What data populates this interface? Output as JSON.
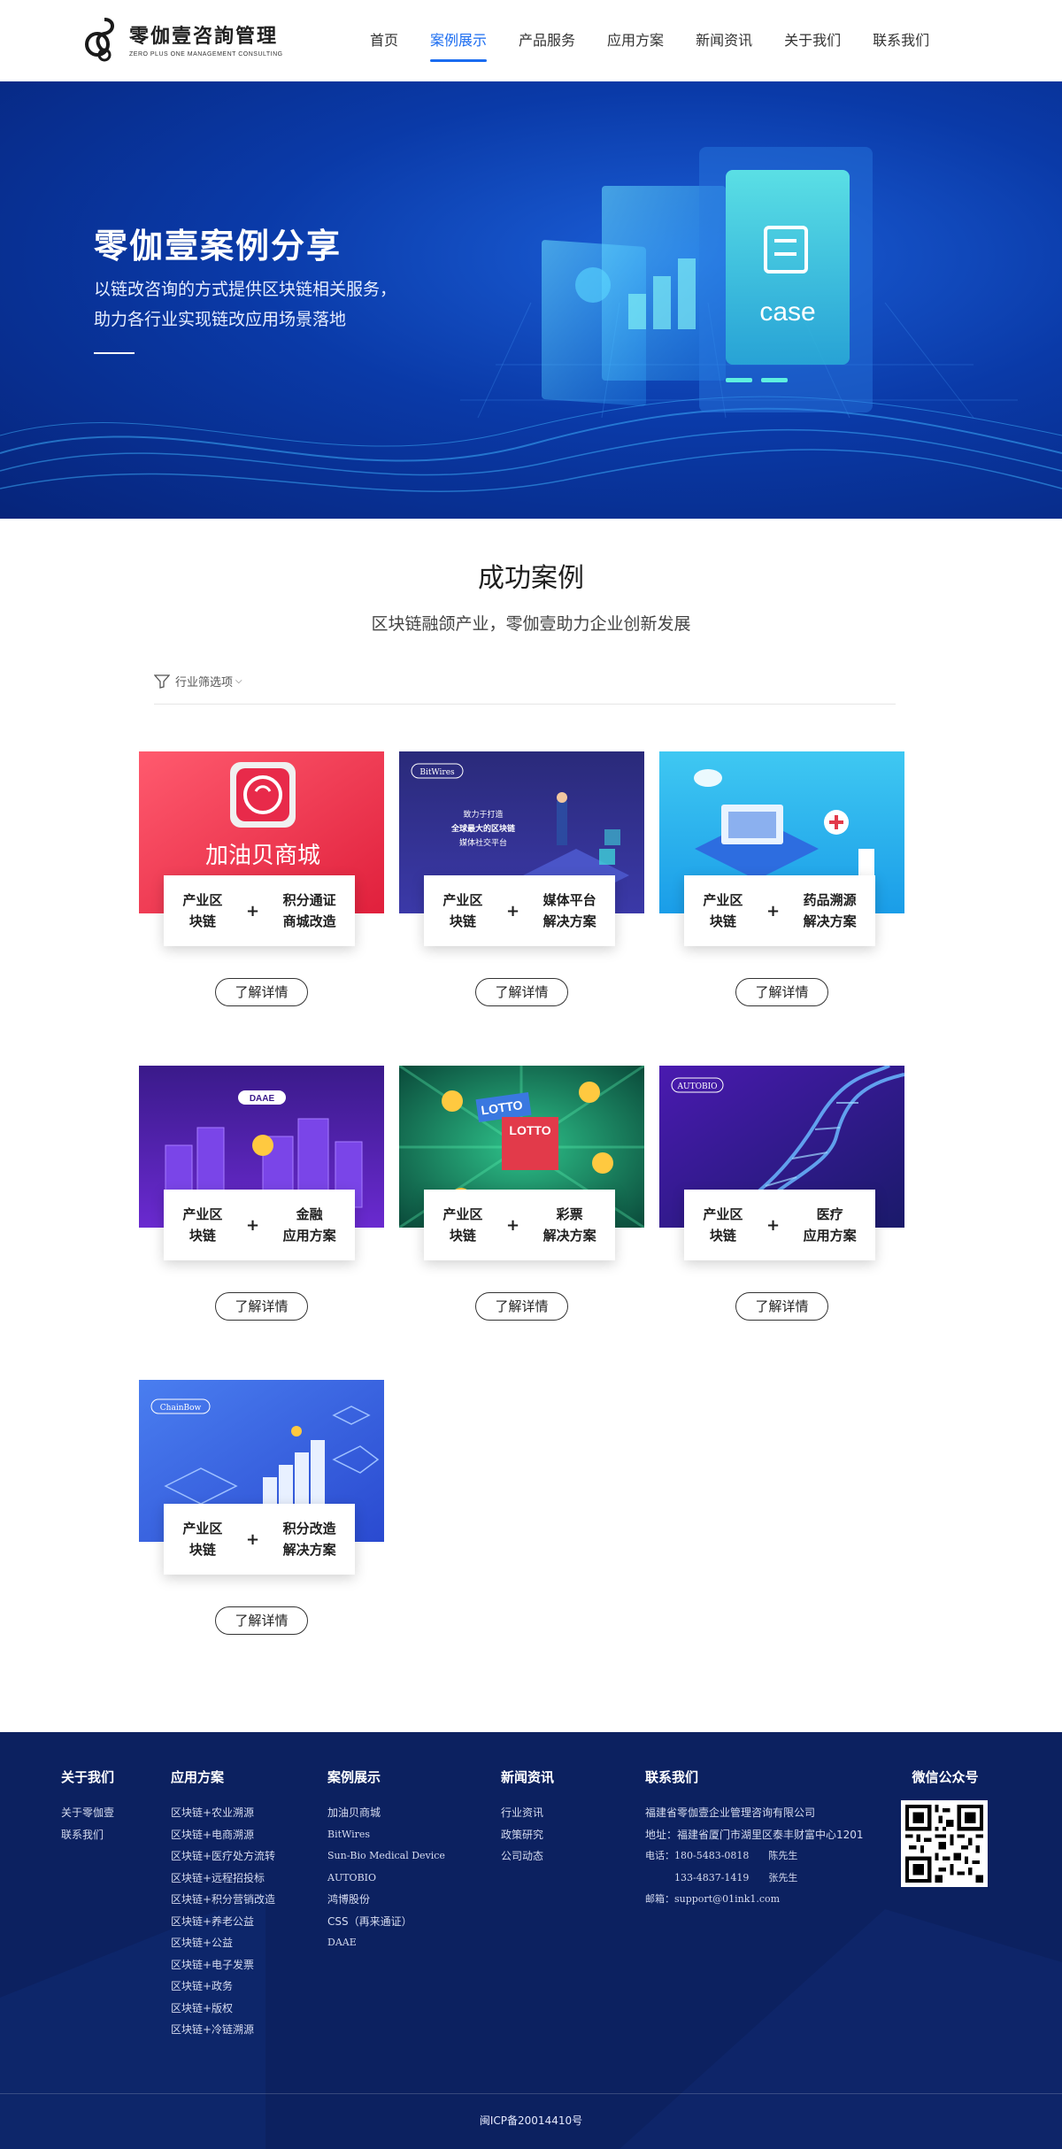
{
  "header": {
    "logo_cn": "零伽壹咨詢管理",
    "logo_en": "ZERO PLUS ONE MANAGEMENT CONSULTING",
    "nav": [
      "首页",
      "案例展示",
      "产品服务",
      "应用方案",
      "新闻资讯",
      "关于我们",
      "联系我们"
    ],
    "active_nav": "案例展示"
  },
  "banner": {
    "title": "零伽壹案例分享",
    "sub_line1": "以链改咨询的方式提供区块链相关服务，",
    "sub_line2": "助力各行业实现链改应用场景落地",
    "panel_text": "case"
  },
  "section": {
    "title": "成功案例",
    "subtitle": "区块链融颌产业，零伽壹助力企业创新发展",
    "filter_label": "行业筛选项"
  },
  "cards": [
    {
      "left": "产业区\n块链",
      "right": "积分通证\n商城改造",
      "button": "了解详情",
      "img_text": "加油贝商城"
    },
    {
      "left": "产业区\n块链",
      "right": "媒体平台\n解决方案",
      "button": "了解详情",
      "img_text": "BitWires",
      "img_text2": "致力于打造",
      "img_text3": "全球最大的区块链",
      "img_text4": "媒体社交平台"
    },
    {
      "left": "产业区\n块链",
      "right": "药品溯源\n解决方案",
      "button": "了解详情"
    },
    {
      "left": "产业区\n块链",
      "right": "金融\n应用方案",
      "button": "了解详情",
      "img_text": "DAAE"
    },
    {
      "left": "产业区\n块链",
      "right": "彩票\n解决方案",
      "button": "了解详情",
      "img_text": "LOTTO",
      "img_text2": "LOTTO"
    },
    {
      "left": "产业区\n块链",
      "right": "医疗\n应用方案",
      "button": "了解详情",
      "img_text": "AUTOBIO"
    },
    {
      "left": "产业区\n块链",
      "right": "积分改造\n解决方案",
      "button": "了解详情",
      "img_text": "ChainBow"
    }
  ],
  "footer": {
    "about": {
      "title": "关于我们",
      "items": [
        "关于零伽壹",
        "联系我们"
      ]
    },
    "solutions": {
      "title": "应用方案",
      "items": [
        "区块链+农业溯源",
        "区块链+电商溯源",
        "区块链+医疗处方流转",
        "区块链+远程招投标",
        "区块链+积分营销改造",
        "区块链+养老公益",
        "区块链+公益",
        "区块链+电子发票",
        "区块链+政务",
        "区块链+版权",
        "区块链+冷链溯源"
      ]
    },
    "cases": {
      "title": "案例展示",
      "items": [
        "加油贝商城",
        "BitWires",
        "Sun-Bio Medical Device",
        "AUTOBIO",
        "鸿博股份",
        "CSS（再来通证）",
        "DAAE"
      ]
    },
    "news": {
      "title": "新闻资讯",
      "items": [
        "行业资讯",
        "政策研究",
        "公司动态"
      ]
    },
    "contact": {
      "title": "联系我们",
      "company": "福建省零伽壹企业管理咨询有限公司",
      "address": "地址：福建省厦门市湖里区泰丰财富中心1201",
      "phone1": "电话：180-5483-0818　　陈先生",
      "phone2": "　　　133-4837-1419　　张先生",
      "email": "邮箱：support@01ink1.com"
    },
    "wechat_title": "微信公众号",
    "icp": "闽ICP备20014410号"
  }
}
